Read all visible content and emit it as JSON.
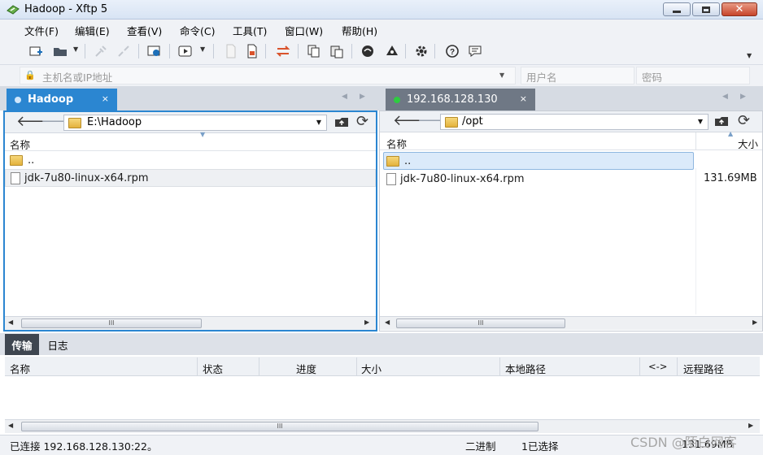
{
  "window": {
    "title": "Hadoop - Xftp 5"
  },
  "menu": [
    "文件(F)",
    "编辑(E)",
    "查看(V)",
    "命令(C)",
    "工具(T)",
    "窗口(W)",
    "帮助(H)"
  ],
  "address": {
    "host_placeholder": "主机名或IP地址",
    "user_placeholder": "用户名",
    "password_placeholder": "密码"
  },
  "tabs": {
    "left": {
      "label": "Hadoop",
      "close": "×"
    },
    "right": {
      "label": "192.168.128.130",
      "close": "×"
    }
  },
  "left_pane": {
    "path": "E:\\Hadoop",
    "col_name": "名称",
    "rows": [
      {
        "name": ".."
      },
      {
        "name": "jdk-7u80-linux-x64.rpm"
      }
    ]
  },
  "right_pane": {
    "path": "/opt",
    "col_name": "名称",
    "col_size": "大小",
    "rows": [
      {
        "name": "..",
        "size": ""
      },
      {
        "name": "jdk-7u80-linux-x64.rpm",
        "size": "131.69MB"
      }
    ]
  },
  "bottom": {
    "tabs": [
      "传输",
      "日志"
    ],
    "columns": [
      "名称",
      "状态",
      "进度",
      "大小",
      "本地路径",
      "<->",
      "远程路径"
    ]
  },
  "status": {
    "connected": "已连接 192.168.128.130:22。",
    "mode": "二进制",
    "selected": "1已选择",
    "size": "131.69MB"
  },
  "watermark": "CSDN @陌白网客",
  "colors": {
    "accent": "#2b86d1",
    "active_tab": "#2b86d1",
    "remote_tab": "#6f7885",
    "connected_dot": "#2ecc40"
  }
}
